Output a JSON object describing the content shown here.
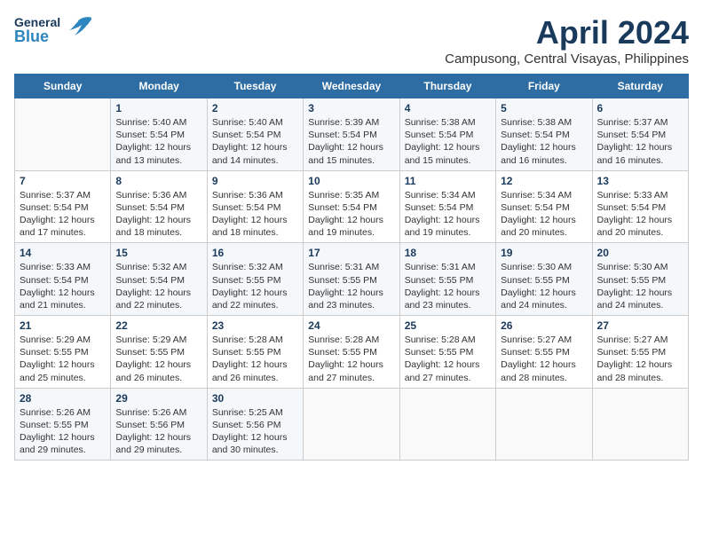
{
  "header": {
    "logo_general": "General",
    "logo_blue": "Blue",
    "month_title": "April 2024",
    "subtitle": "Campusong, Central Visayas, Philippines"
  },
  "days_of_week": [
    "Sunday",
    "Monday",
    "Tuesday",
    "Wednesday",
    "Thursday",
    "Friday",
    "Saturday"
  ],
  "weeks": [
    [
      {
        "day": "",
        "info": ""
      },
      {
        "day": "1",
        "info": "Sunrise: 5:40 AM\nSunset: 5:54 PM\nDaylight: 12 hours\nand 13 minutes."
      },
      {
        "day": "2",
        "info": "Sunrise: 5:40 AM\nSunset: 5:54 PM\nDaylight: 12 hours\nand 14 minutes."
      },
      {
        "day": "3",
        "info": "Sunrise: 5:39 AM\nSunset: 5:54 PM\nDaylight: 12 hours\nand 15 minutes."
      },
      {
        "day": "4",
        "info": "Sunrise: 5:38 AM\nSunset: 5:54 PM\nDaylight: 12 hours\nand 15 minutes."
      },
      {
        "day": "5",
        "info": "Sunrise: 5:38 AM\nSunset: 5:54 PM\nDaylight: 12 hours\nand 16 minutes."
      },
      {
        "day": "6",
        "info": "Sunrise: 5:37 AM\nSunset: 5:54 PM\nDaylight: 12 hours\nand 16 minutes."
      }
    ],
    [
      {
        "day": "7",
        "info": "Sunrise: 5:37 AM\nSunset: 5:54 PM\nDaylight: 12 hours\nand 17 minutes."
      },
      {
        "day": "8",
        "info": "Sunrise: 5:36 AM\nSunset: 5:54 PM\nDaylight: 12 hours\nand 18 minutes."
      },
      {
        "day": "9",
        "info": "Sunrise: 5:36 AM\nSunset: 5:54 PM\nDaylight: 12 hours\nand 18 minutes."
      },
      {
        "day": "10",
        "info": "Sunrise: 5:35 AM\nSunset: 5:54 PM\nDaylight: 12 hours\nand 19 minutes."
      },
      {
        "day": "11",
        "info": "Sunrise: 5:34 AM\nSunset: 5:54 PM\nDaylight: 12 hours\nand 19 minutes."
      },
      {
        "day": "12",
        "info": "Sunrise: 5:34 AM\nSunset: 5:54 PM\nDaylight: 12 hours\nand 20 minutes."
      },
      {
        "day": "13",
        "info": "Sunrise: 5:33 AM\nSunset: 5:54 PM\nDaylight: 12 hours\nand 20 minutes."
      }
    ],
    [
      {
        "day": "14",
        "info": "Sunrise: 5:33 AM\nSunset: 5:54 PM\nDaylight: 12 hours\nand 21 minutes."
      },
      {
        "day": "15",
        "info": "Sunrise: 5:32 AM\nSunset: 5:54 PM\nDaylight: 12 hours\nand 22 minutes."
      },
      {
        "day": "16",
        "info": "Sunrise: 5:32 AM\nSunset: 5:55 PM\nDaylight: 12 hours\nand 22 minutes."
      },
      {
        "day": "17",
        "info": "Sunrise: 5:31 AM\nSunset: 5:55 PM\nDaylight: 12 hours\nand 23 minutes."
      },
      {
        "day": "18",
        "info": "Sunrise: 5:31 AM\nSunset: 5:55 PM\nDaylight: 12 hours\nand 23 minutes."
      },
      {
        "day": "19",
        "info": "Sunrise: 5:30 AM\nSunset: 5:55 PM\nDaylight: 12 hours\nand 24 minutes."
      },
      {
        "day": "20",
        "info": "Sunrise: 5:30 AM\nSunset: 5:55 PM\nDaylight: 12 hours\nand 24 minutes."
      }
    ],
    [
      {
        "day": "21",
        "info": "Sunrise: 5:29 AM\nSunset: 5:55 PM\nDaylight: 12 hours\nand 25 minutes."
      },
      {
        "day": "22",
        "info": "Sunrise: 5:29 AM\nSunset: 5:55 PM\nDaylight: 12 hours\nand 26 minutes."
      },
      {
        "day": "23",
        "info": "Sunrise: 5:28 AM\nSunset: 5:55 PM\nDaylight: 12 hours\nand 26 minutes."
      },
      {
        "day": "24",
        "info": "Sunrise: 5:28 AM\nSunset: 5:55 PM\nDaylight: 12 hours\nand 27 minutes."
      },
      {
        "day": "25",
        "info": "Sunrise: 5:28 AM\nSunset: 5:55 PM\nDaylight: 12 hours\nand 27 minutes."
      },
      {
        "day": "26",
        "info": "Sunrise: 5:27 AM\nSunset: 5:55 PM\nDaylight: 12 hours\nand 28 minutes."
      },
      {
        "day": "27",
        "info": "Sunrise: 5:27 AM\nSunset: 5:55 PM\nDaylight: 12 hours\nand 28 minutes."
      }
    ],
    [
      {
        "day": "28",
        "info": "Sunrise: 5:26 AM\nSunset: 5:55 PM\nDaylight: 12 hours\nand 29 minutes."
      },
      {
        "day": "29",
        "info": "Sunrise: 5:26 AM\nSunset: 5:56 PM\nDaylight: 12 hours\nand 29 minutes."
      },
      {
        "day": "30",
        "info": "Sunrise: 5:25 AM\nSunset: 5:56 PM\nDaylight: 12 hours\nand 30 minutes."
      },
      {
        "day": "",
        "info": ""
      },
      {
        "day": "",
        "info": ""
      },
      {
        "day": "",
        "info": ""
      },
      {
        "day": "",
        "info": ""
      }
    ]
  ]
}
